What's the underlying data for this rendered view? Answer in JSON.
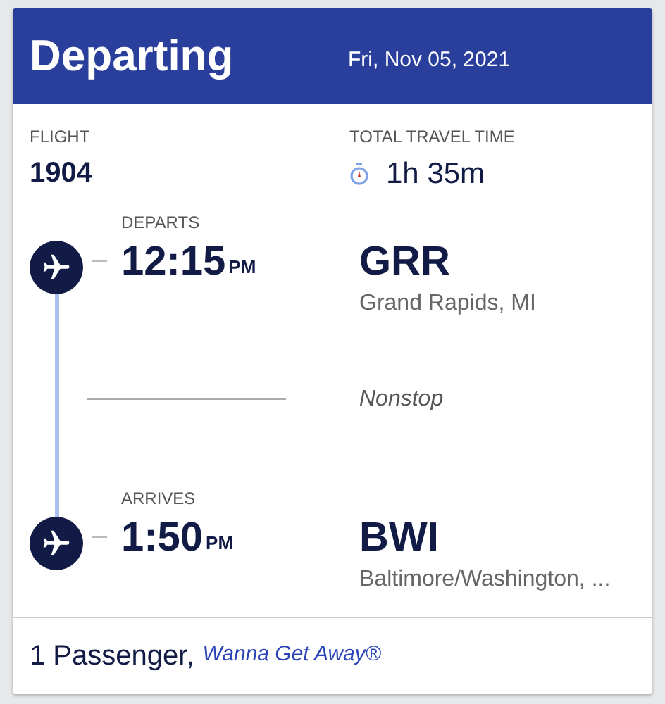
{
  "header": {
    "title": "Departing",
    "date": "Fri, Nov 05, 2021"
  },
  "flight": {
    "label": "FLIGHT",
    "number": "1904"
  },
  "travel_time": {
    "label": "TOTAL TRAVEL TIME",
    "value": "1h 35m"
  },
  "stops": [
    {
      "label": "DEPARTS",
      "time": "12:15",
      "ampm": "PM",
      "code": "GRR",
      "city": "Grand Rapids, MI"
    },
    {
      "label": "ARRIVES",
      "time": "1:50",
      "ampm": "PM",
      "code": "BWI",
      "city": "Baltimore/Washington, ..."
    }
  ],
  "connection": "Nonstop",
  "footer": {
    "passengers": "1 Passenger,",
    "fare": "Wanna Get Away®"
  }
}
